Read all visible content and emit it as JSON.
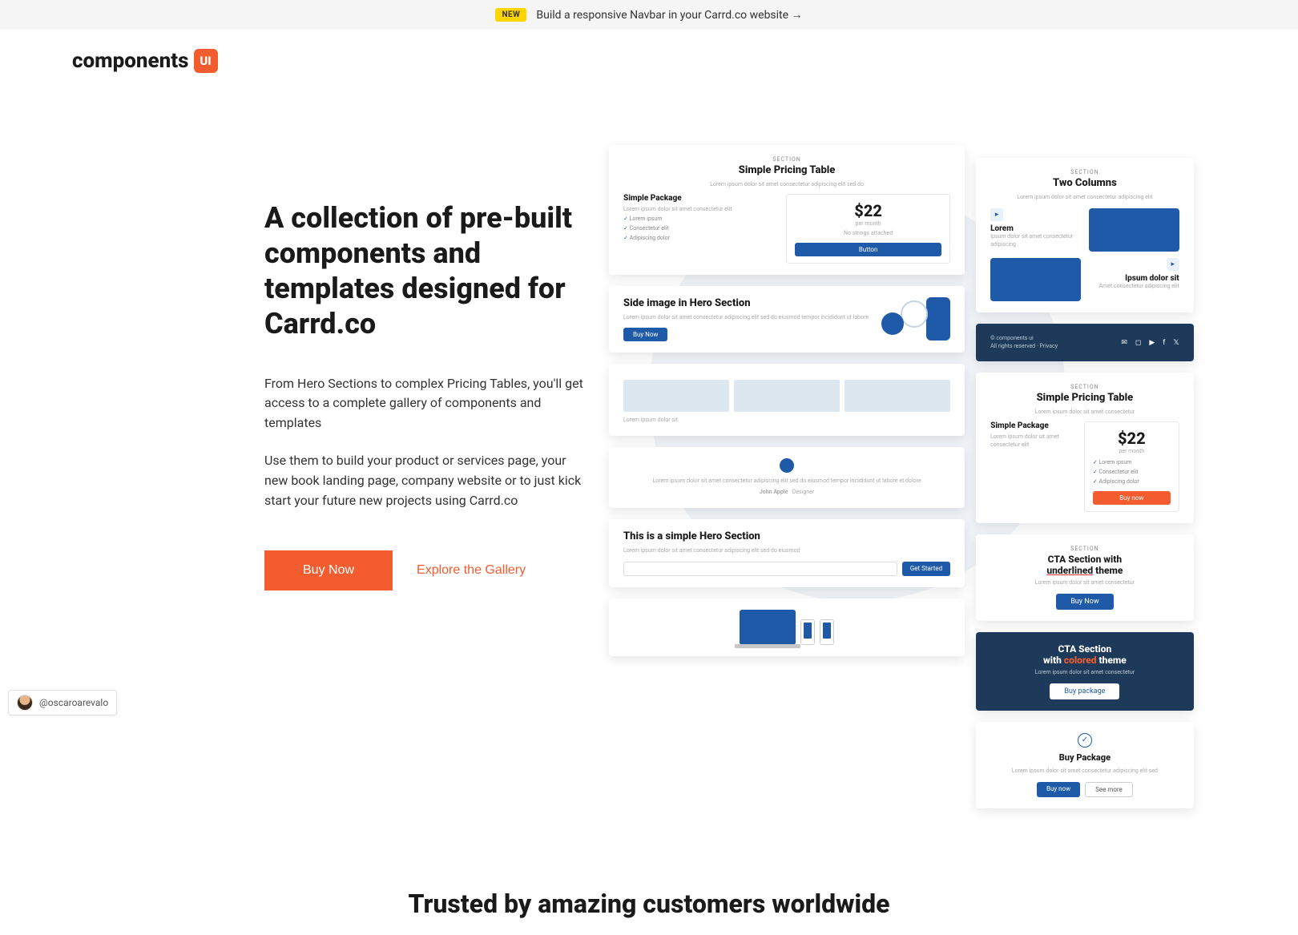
{
  "announcement": {
    "badge": "NEW",
    "text": "Build a responsive Navbar in your Carrd.co website →"
  },
  "logo": {
    "text": "components",
    "icon": "UI"
  },
  "hero": {
    "title": "A collection of pre-built components and templates designed for Carrd.co",
    "p1": "From Hero Sections to complex Pricing Tables, you'll get access to a complete gallery of components and templates",
    "p2": "Use them to build your product or services page, your new book landing page, company website or to just kick start your future new projects using Carrd.co",
    "buy_label": "Buy Now",
    "explore_label": "Explore the Gallery"
  },
  "cards": {
    "section_label": "SECTION",
    "pricing": {
      "title": "Simple Pricing Table",
      "package": "Simple Package",
      "price": "$22",
      "per": "per month",
      "feat1": "Lorem ipsum",
      "feat2": "Consectetur elit",
      "feat3": "Adipiscing dolor",
      "button": "Button"
    },
    "twocol": {
      "title": "Two Columns",
      "lorem": "Lorem",
      "right": "Ipsum dolor sit"
    },
    "sidehero": {
      "title": "Side image in Hero Section",
      "button": "Buy Now"
    },
    "copy": "© components ui",
    "cta": {
      "title_1": "CTA Section with",
      "underlined": "underlined",
      "title_2": " theme",
      "button": "Buy Now"
    },
    "john": "John Apple",
    "simple_hero": {
      "title": "This is a simple Hero Section",
      "btn": "Get Started"
    },
    "cta_colored": {
      "title_1": "CTA Section",
      "title_2": "with ",
      "colored": "colored",
      "title_3": " theme",
      "button": "Buy package"
    },
    "buy_pkg": {
      "title": "Buy Package",
      "btn1": "Buy now",
      "btn2": "See more"
    }
  },
  "trusted": {
    "title": "Trusted by amazing customers worldwide"
  },
  "attribution": {
    "handle": "@oscaroarevalo"
  }
}
